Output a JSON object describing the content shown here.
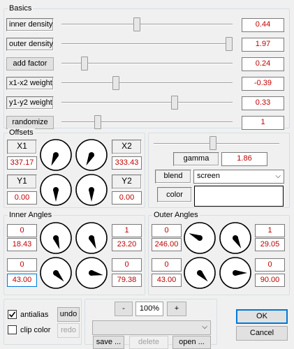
{
  "basics": {
    "title": "Basics",
    "rows": [
      {
        "label": "inner density",
        "value": "0.44",
        "level": 0.44
      },
      {
        "label": "outer density",
        "value": "1.97",
        "level": 1.0
      },
      {
        "label": "add factor",
        "value": "0.24",
        "level": 0.12
      },
      {
        "label": "x1-x2 weight",
        "value": "-0.39",
        "level": 0.31
      },
      {
        "label": "y1-y2 weight",
        "value": "0.33",
        "level": 0.67
      },
      {
        "label": "randomize",
        "value": "1",
        "level": 0.2
      }
    ]
  },
  "offsets": {
    "title": "Offsets",
    "x1": {
      "label": "X1",
      "value": "337.17"
    },
    "x2": {
      "label": "X2",
      "value": "333.43"
    },
    "y1": {
      "label": "Y1",
      "value": "0.00"
    },
    "y2": {
      "label": "Y2",
      "value": "0.00"
    },
    "dial_angles": [
      337.17,
      333.43,
      0,
      0
    ]
  },
  "render": {
    "gamma_label": "gamma",
    "gamma_value": "1.86",
    "gamma_level": 0.47,
    "blend_label": "blend",
    "blend_value": "screen",
    "color_label": "color",
    "color_value": "#ffffff"
  },
  "inner_angles": {
    "title": "Inner Angles",
    "left_top": [
      "0",
      "18.43"
    ],
    "right_top": [
      "1",
      "23.20"
    ],
    "left_bottom": [
      "0",
      "43.00"
    ],
    "right_bottom": [
      "0",
      "79.38"
    ],
    "dial_angles": [
      18.43,
      23.2,
      43.0,
      79.38
    ]
  },
  "outer_angles": {
    "title": "Outer Angles",
    "left_top": [
      "0",
      "246.00"
    ],
    "right_top": [
      "1",
      "29.05"
    ],
    "left_bottom": [
      "0",
      "43.00"
    ],
    "right_bottom": [
      "0",
      "90.00"
    ],
    "dial_angles": [
      246.0,
      29.05,
      43.0,
      90.0
    ]
  },
  "footer": {
    "antialias_label": "antialias",
    "antialias_checked": true,
    "clipcolor_label": "clip color",
    "clipcolor_checked": false,
    "undo_label": "undo",
    "redo_label": "redo",
    "zoom_minus": "-",
    "zoom_value": "100%",
    "zoom_plus": "+",
    "save_label": "save ...",
    "delete_label": "delete",
    "open_label": "open ...",
    "preset_value": "",
    "ok_label": "OK",
    "cancel_label": "Cancel"
  }
}
